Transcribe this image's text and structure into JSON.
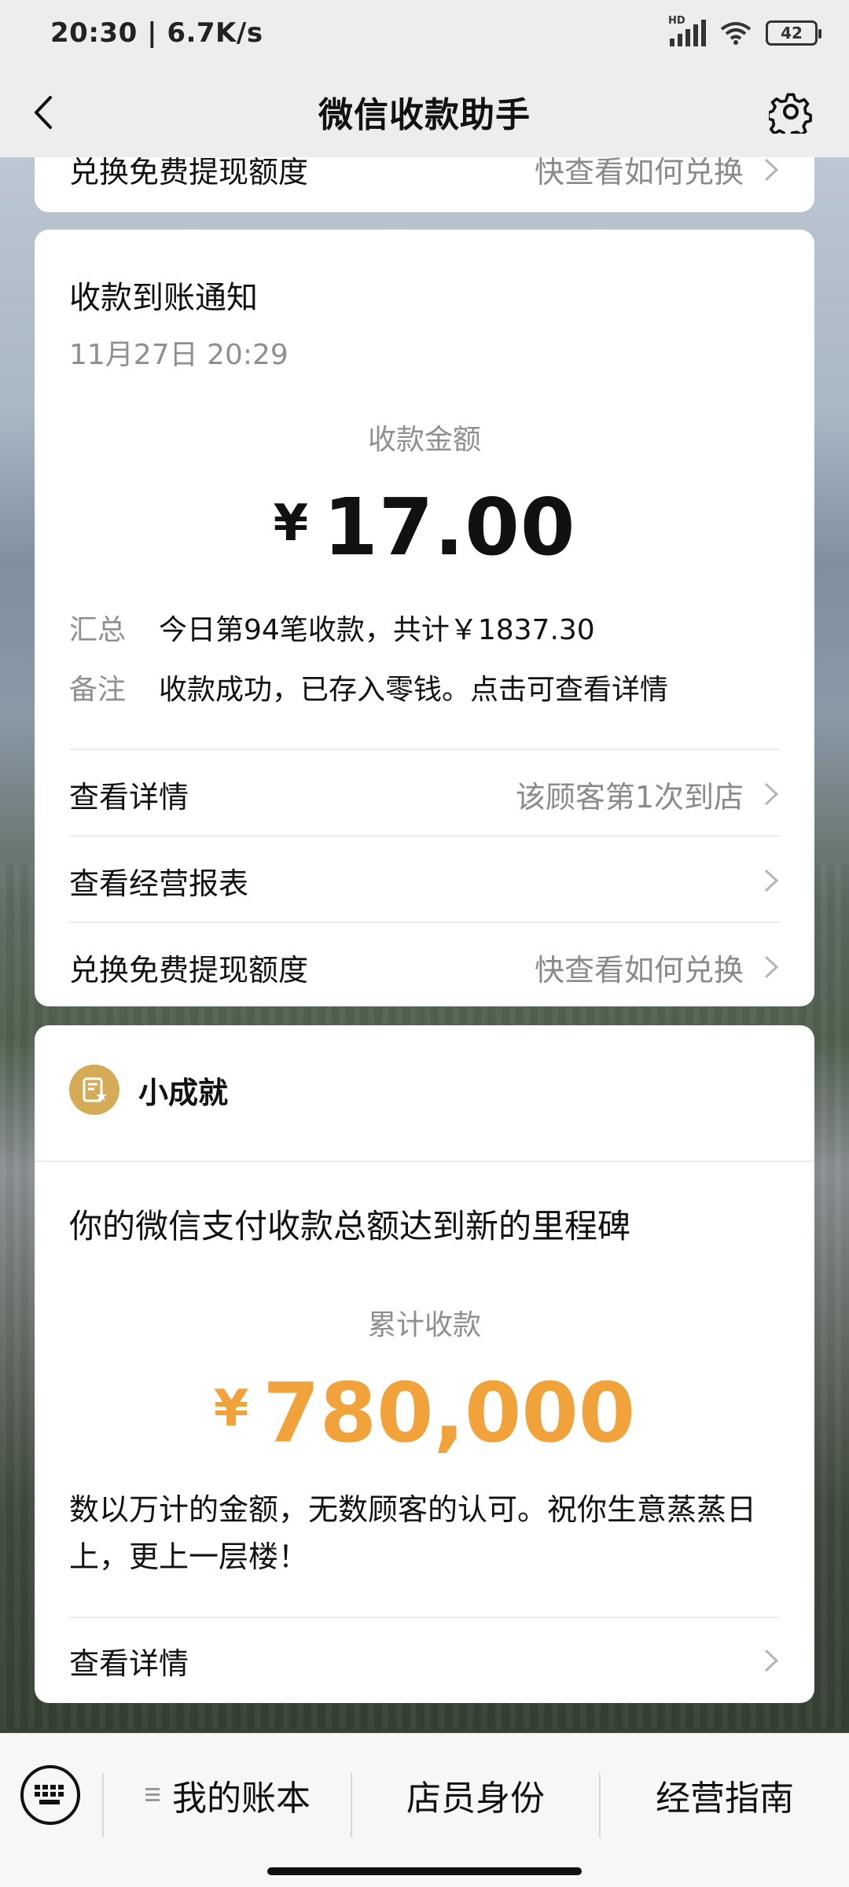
{
  "status_bar": {
    "time": "20:30 | 6.7K/s",
    "hd": "HD",
    "battery": "42"
  },
  "nav": {
    "title": "微信收款助手"
  },
  "top_partial": {
    "label": "兑换免费提现额度",
    "right": "快查看如何兑换"
  },
  "notice": {
    "title": "收款到账通知",
    "time": "11月27日 20:29",
    "amount_label": "收款金额",
    "currency": "¥",
    "amount": "17.00",
    "summary_key": "汇总",
    "summary_value": "今日第94笔收款，共计￥1837.30",
    "remark_key": "备注",
    "remark_value": "收款成功，已存入零钱。点击可查看详情",
    "rows": [
      {
        "label": "查看详情",
        "right": "该顾客第1次到店"
      },
      {
        "label": "查看经营报表",
        "right": ""
      },
      {
        "label": "兑换免费提现额度",
        "right": "快查看如何兑换"
      }
    ]
  },
  "achievement": {
    "head_label": "小成就",
    "headline": "你的微信支付收款总额达到新的里程碑",
    "amount_label": "累计收款",
    "currency": "¥",
    "amount": "780,000",
    "message": "数以万计的金额，无数顾客的认可。祝你生意蒸蒸日上，更上一层楼！",
    "detail_label": "查看详情",
    "accent_color": "#f2a23a",
    "badge_color": "#d5ab58"
  },
  "bottom_bar": {
    "tabs": [
      "我的账本",
      "店员身份",
      "经营指南"
    ]
  }
}
